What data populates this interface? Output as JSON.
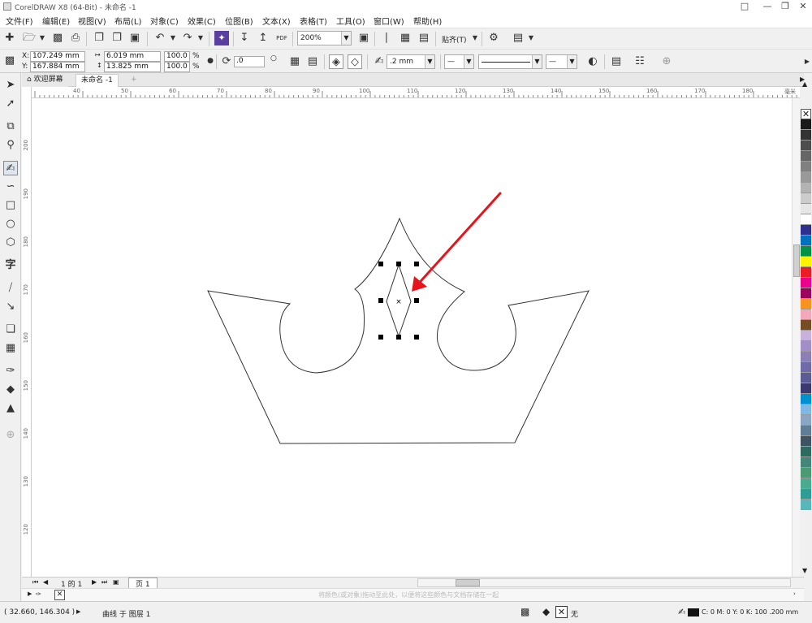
{
  "window": {
    "title": "CorelDRAW X8 (64-Bit) - 未命名 -1"
  },
  "menu": [
    "文件(F)",
    "编辑(E)",
    "视图(V)",
    "布局(L)",
    "对象(C)",
    "效果(C)",
    "位图(B)",
    "文本(X)",
    "表格(T)",
    "工具(O)",
    "窗口(W)",
    "帮助(H)"
  ],
  "toolbar": {
    "zoom": "200%",
    "snap_label": "贴齐(T)",
    "pdf_label": "PDF"
  },
  "props": {
    "x_label": "X:",
    "x": "107.249 mm",
    "y_label": "Y:",
    "y": "167.884 mm",
    "w": "6.019 mm",
    "h": "13.825 mm",
    "sx": "100.0",
    "sy": "100.0",
    "pct": "%",
    "rotation": ".0",
    "outline_width": ".2 mm"
  },
  "tabs": {
    "welcome": "欢迎屏幕",
    "doc": "未命名 -1"
  },
  "ruler": {
    "h_ticks": [
      "40",
      "50",
      "60",
      "70",
      "80",
      "90",
      "100",
      "110",
      "120",
      "130",
      "140",
      "150",
      "160",
      "170",
      "180"
    ],
    "unit": "毫米",
    "v_ticks": [
      "200",
      "190",
      "180",
      "170",
      "160",
      "150",
      "140",
      "130",
      "120"
    ]
  },
  "pages": {
    "count": "1 的 1",
    "page_tab": "页 1"
  },
  "hint": "将颜色(或对象)拖动至此处，以便将这些颜色与文档存储在一起",
  "status": {
    "coords": "( 32.660, 146.304 )",
    "object": "曲线 于 图层 1",
    "fill_none": "无",
    "outline": "C: 0 M: 0 Y: 0 K: 100  .200 mm"
  },
  "palette": [
    "#1a1a1a",
    "#333333",
    "#4d4d4d",
    "#666666",
    "#808080",
    "#999999",
    "#b3b3b3",
    "#cccccc",
    "#e6e6e6",
    "#ffffff",
    "#2e3192",
    "#0071bc",
    "#009245",
    "#fff200",
    "#ed1c24",
    "#ec008c",
    "#9e005d",
    "#f7931e",
    "#f4a7b9",
    "#754c24",
    "#c7b2de",
    "#a18fc7",
    "#8c7fb5",
    "#6f6aa8",
    "#5b5b95",
    "#3a3a70",
    "#0090d0",
    "#7fb8e6",
    "#8ba5c4",
    "#607d96",
    "#3f5463",
    "#2c6b5e",
    "#43877a",
    "#4a9a74",
    "#4aab8e",
    "#2e9d96",
    "#56b8b8"
  ],
  "annotation": {
    "arrow_color": "#e8141b"
  }
}
